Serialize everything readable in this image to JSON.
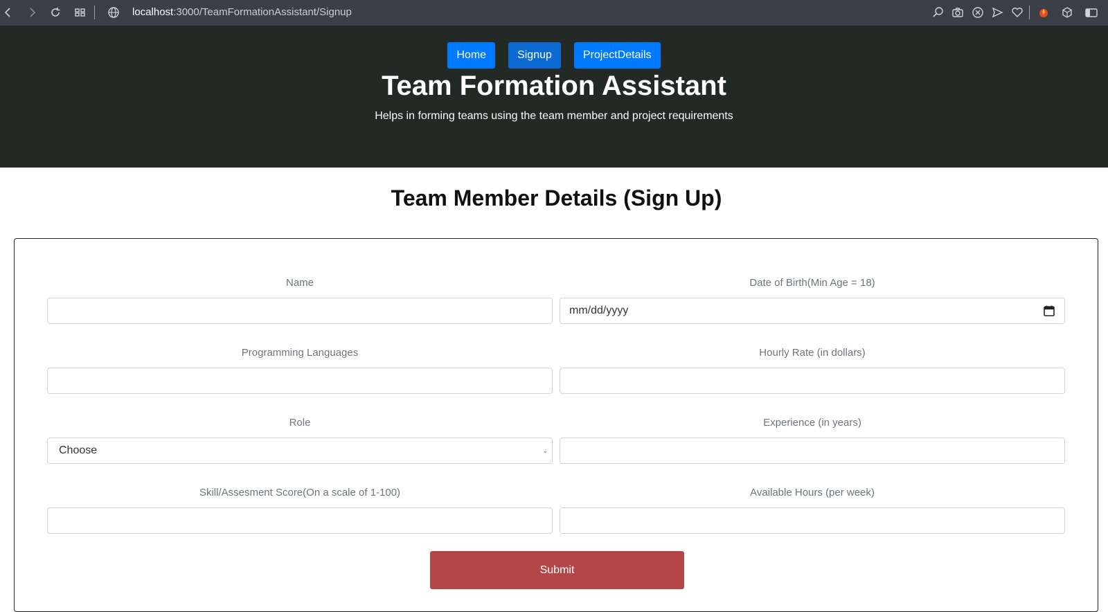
{
  "browser": {
    "url_host": "localhost",
    "url_rest": ":3000/TeamFormationAssistant/Signup"
  },
  "nav": {
    "items": [
      {
        "label": "Home"
      },
      {
        "label": "Signup"
      },
      {
        "label": "ProjectDetails"
      }
    ]
  },
  "hero": {
    "title": "Team Formation Assistant",
    "subtitle": "Helps in forming teams using the team member and project requirements"
  },
  "page": {
    "title": "Team Member Details (Sign Up)"
  },
  "form": {
    "name": {
      "label": "Name",
      "value": ""
    },
    "dob": {
      "label": "Date of Birth(Min Age = 18)",
      "placeholder": "mm/dd/yyyy"
    },
    "languages": {
      "label": "Programming Languages",
      "value": ""
    },
    "hourly_rate": {
      "label": "Hourly Rate (in dollars)",
      "value": ""
    },
    "role": {
      "label": "Role",
      "selected": "Choose"
    },
    "experience": {
      "label": "Experience (in years)",
      "value": ""
    },
    "skill_score": {
      "label": "Skill/Assesment Score(On a scale of 1-100)",
      "value": ""
    },
    "available_hours": {
      "label": "Available Hours (per week)",
      "value": ""
    },
    "submit_label": "Submit"
  },
  "colors": {
    "nav_button": "#007bff",
    "hero_background": "#232a26",
    "submit_button": "#b34747"
  }
}
